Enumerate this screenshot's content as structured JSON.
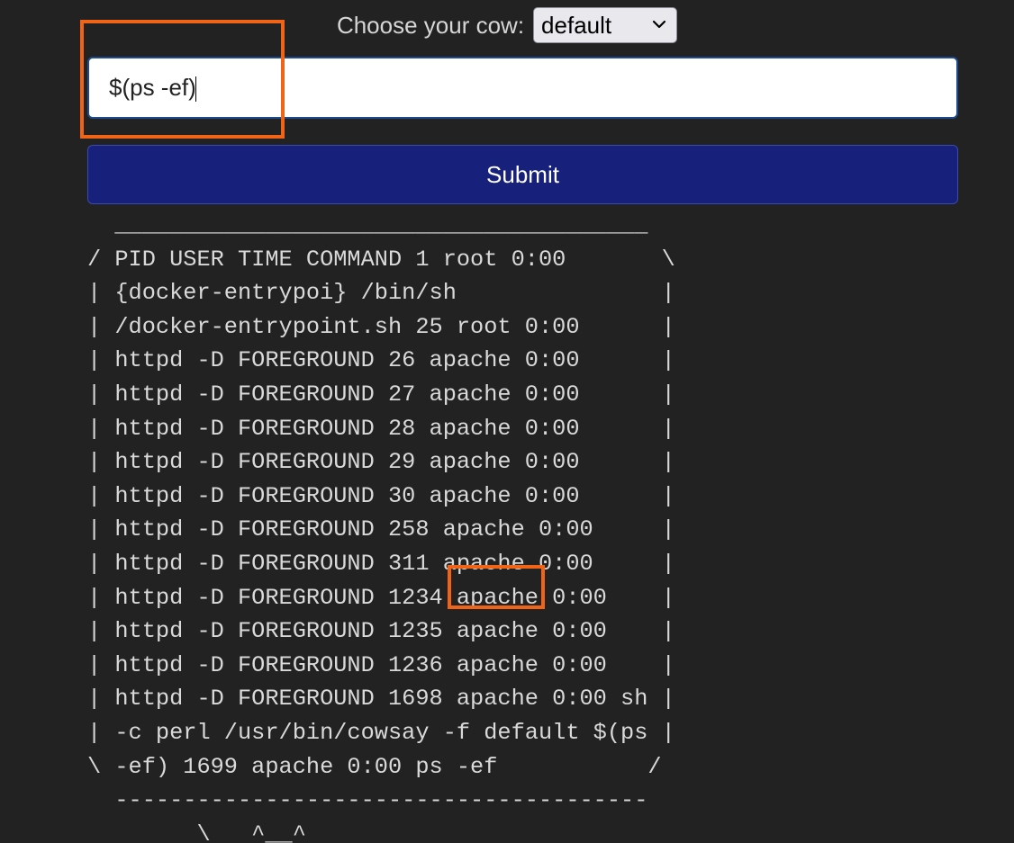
{
  "cow_selector": {
    "label": "Choose your cow:",
    "selected": "default"
  },
  "message_input": {
    "value": "$(ps -ef)"
  },
  "submit_button": {
    "label": "Submit"
  },
  "output_text": "  _______________________________________\n/ PID USER TIME COMMAND 1 root 0:00       \\\n| {docker-entrypoi} /bin/sh               |\n| /docker-entrypoint.sh 25 root 0:00      |\n| httpd -D FOREGROUND 26 apache 0:00      |\n| httpd -D FOREGROUND 27 apache 0:00      |\n| httpd -D FOREGROUND 28 apache 0:00      |\n| httpd -D FOREGROUND 29 apache 0:00      |\n| httpd -D FOREGROUND 30 apache 0:00      |\n| httpd -D FOREGROUND 258 apache 0:00     |\n| httpd -D FOREGROUND 311 apache 0:00     |\n| httpd -D FOREGROUND 1234 apache 0:00    |\n| httpd -D FOREGROUND 1235 apache 0:00    |\n| httpd -D FOREGROUND 1236 apache 0:00    |\n| httpd -D FOREGROUND 1698 apache 0:00 sh |\n| -c perl /usr/bin/cowsay -f default $(ps |\n\\ -ef) 1699 apache 0:00 ps -ef           /\n  ---------------------------------------\n        \\   ^__^",
  "colors": {
    "background": "#222222",
    "button": "#17207a",
    "highlight_box": "#f06418"
  },
  "icons": {
    "select_arrow": "chevron-down-icon"
  }
}
